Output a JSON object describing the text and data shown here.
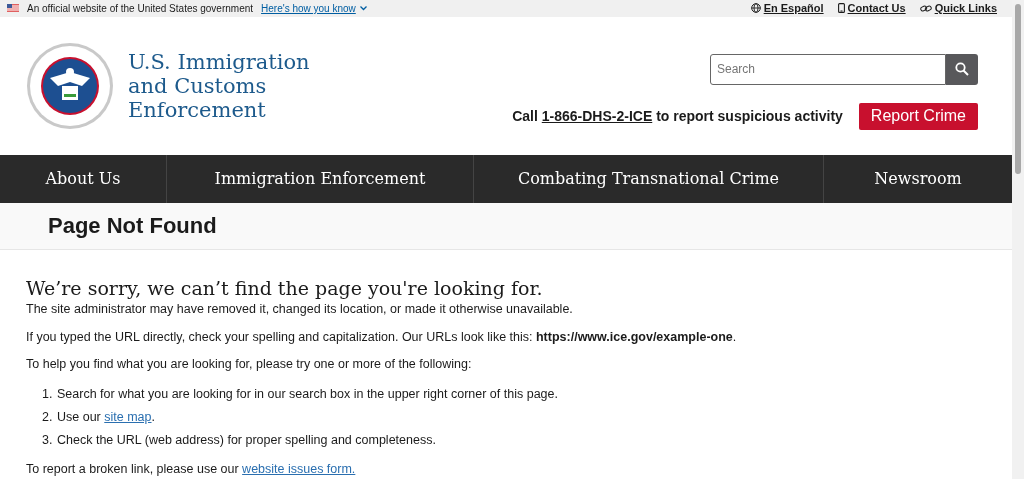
{
  "gov_banner": {
    "text": "An official website of the United States government",
    "link": "Here's how you know"
  },
  "utility_links": [
    {
      "kind": "globe",
      "label": "En Español"
    },
    {
      "kind": "phone",
      "label": "Contact Us"
    },
    {
      "kind": "link",
      "label": "Quick Links"
    }
  ],
  "logo": {
    "lines": [
      "U.S. Immigration",
      "and Customs",
      "Enforcement"
    ]
  },
  "search": {
    "placeholder": "Search"
  },
  "hotline": {
    "before": "Call",
    "phone": "1-866-DHS-2-ICE",
    "after": "to report suspicious activity"
  },
  "report_button": "Report Crime",
  "nav": [
    {
      "label": "About Us"
    },
    {
      "label": "Immigration Enforcement"
    },
    {
      "label": "Combating Transnational Crime"
    },
    {
      "label": "Newsroom"
    }
  ],
  "page_title": "Page Not Found",
  "heading": "We’re sorry, we can’t find the page you're looking for.",
  "paragraphs": [
    {
      "text": "The site administrator may have removed it, changed its location, or made it otherwise unavailable."
    },
    {
      "text": "If you typed the URL directly, check your spelling and capitalization. Our URLs look like this: **https://www.ice.gov/example-one**."
    },
    {
      "text": "To help you find what you are looking for, please try one or more of the following:"
    }
  ],
  "steps": [
    {
      "marker": "1.",
      "before": "Search for what you are looking for in our search box in the upper right corner of this page."
    },
    {
      "marker": "2.",
      "before": "Use our",
      "link": "site map",
      "after": "."
    },
    {
      "marker": "3.",
      "before": "Check the URL (web address) for proper spelling and completeness."
    }
  ],
  "footer_note": {
    "before": "To report a broken link, please use our",
    "link": "website issues form."
  }
}
